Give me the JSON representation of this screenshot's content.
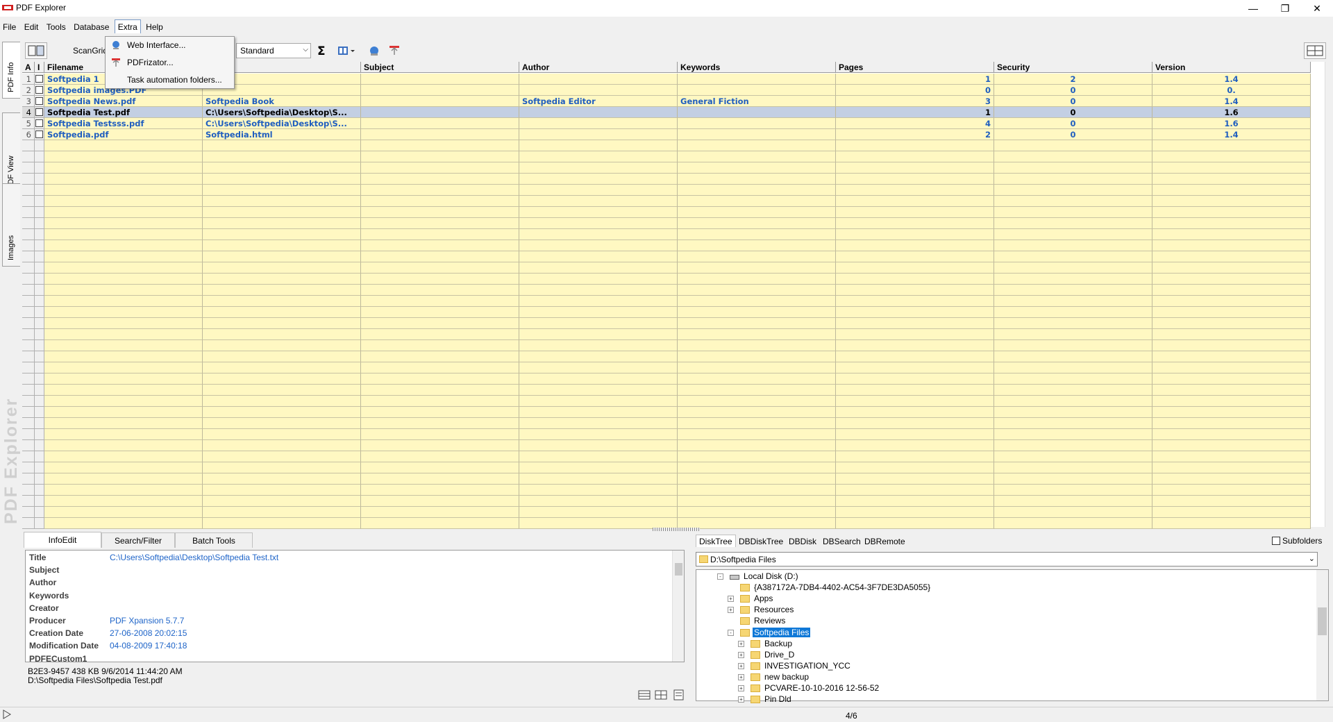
{
  "window": {
    "title": "PDF Explorer"
  },
  "menu": [
    "File",
    "Edit",
    "Tools",
    "Database",
    "Extra",
    "Help"
  ],
  "extra_menu": [
    "Web Interface...",
    "PDFrizator...",
    "Task automation folders..."
  ],
  "side_tabs": [
    "PDF Info",
    "PDF View",
    "Images"
  ],
  "watermark": "PDF Explorer",
  "toolbar": {
    "scangrid_label": "ScanGrid",
    "view_combo": "Standard"
  },
  "grid": {
    "headers": [
      "A",
      "I",
      "Filename",
      "",
      "Subject",
      "Author",
      "Keywords",
      "Pages",
      "Security",
      "Version"
    ],
    "rows": [
      {
        "idx": "1",
        "filename": "Softpedia 1",
        "title": "",
        "subject": "",
        "author": "",
        "keywords": "",
        "pages": "1",
        "security": "2",
        "version": "1.4"
      },
      {
        "idx": "2",
        "filename": "Softpedia images.PDF",
        "title": "",
        "subject": "",
        "author": "",
        "keywords": "",
        "pages": "0",
        "security": "0",
        "version": "0."
      },
      {
        "idx": "3",
        "filename": "Softpedia News.pdf",
        "title": "Softpedia Book",
        "subject": "",
        "author": "Softpedia Editor",
        "keywords": "General Fiction",
        "pages": "3",
        "security": "0",
        "version": "1.4"
      },
      {
        "idx": "4",
        "filename": "Softpedia Test.pdf",
        "title": "C:\\Users\\Softpedia\\Desktop\\S...",
        "subject": "",
        "author": "",
        "keywords": "",
        "pages": "1",
        "security": "0",
        "version": "1.6"
      },
      {
        "idx": "5",
        "filename": "Softpedia Testsss.pdf",
        "title": "C:\\Users\\Softpedia\\Desktop\\S...",
        "subject": "",
        "author": "",
        "keywords": "",
        "pages": "4",
        "security": "0",
        "version": "1.6"
      },
      {
        "idx": "6",
        "filename": "Softpedia.pdf",
        "title": "Softpedia.html",
        "subject": "",
        "author": "",
        "keywords": "",
        "pages": "2",
        "security": "0",
        "version": "1.4"
      }
    ]
  },
  "left_tabs": [
    "InfoEdit",
    "Search/Filter",
    "Batch Tools"
  ],
  "info": [
    {
      "label": "Title",
      "value": "C:\\Users\\Softpedia\\Desktop\\Softpedia Test.txt"
    },
    {
      "label": "Subject",
      "value": ""
    },
    {
      "label": "Author",
      "value": ""
    },
    {
      "label": "Keywords",
      "value": ""
    },
    {
      "label": "Creator",
      "value": ""
    },
    {
      "label": "Producer",
      "value": "PDF Xpansion 5.7.7"
    },
    {
      "label": "Creation Date",
      "value": "27-06-2008 20:02:15"
    },
    {
      "label": "Modification Date",
      "value": "04-08-2009 17:40:18"
    },
    {
      "label": "PDFECustom1",
      "value": ""
    }
  ],
  "status": {
    "line1": "B2E3-9457      438 KB   9/6/2014 11:44:20 AM",
    "line2": "D:\\Softpedia Files\\Softpedia Test.pdf"
  },
  "right_tabs": [
    "DiskTree",
    "DBDiskTree",
    "DBDisk",
    "DBSearch",
    "DBRemote"
  ],
  "subfolders_label": "Subfolders",
  "path": "D:\\Softpedia Files",
  "tree": [
    {
      "label": "Local Disk (D:)",
      "level": 0,
      "exp": "-",
      "drive": true
    },
    {
      "label": "{A387172A-7DB4-4402-AC54-3F7DE3DA5055}",
      "level": 1,
      "exp": ""
    },
    {
      "label": "Apps",
      "level": 1,
      "exp": "+"
    },
    {
      "label": "Resources",
      "level": 1,
      "exp": "+"
    },
    {
      "label": "Reviews",
      "level": 1,
      "exp": ""
    },
    {
      "label": "Softpedia Files",
      "level": 1,
      "exp": "-",
      "sel": true
    },
    {
      "label": "Backup",
      "level": 2,
      "exp": "+"
    },
    {
      "label": "Drive_D",
      "level": 2,
      "exp": "+"
    },
    {
      "label": "INVESTIGATION_YCC",
      "level": 2,
      "exp": "+"
    },
    {
      "label": "new backup",
      "level": 2,
      "exp": "+"
    },
    {
      "label": "PCVARE-10-10-2016 12-56-52",
      "level": 2,
      "exp": "+"
    },
    {
      "label": "Pin Dld",
      "level": 2,
      "exp": "+"
    }
  ],
  "page_count": "4/6"
}
